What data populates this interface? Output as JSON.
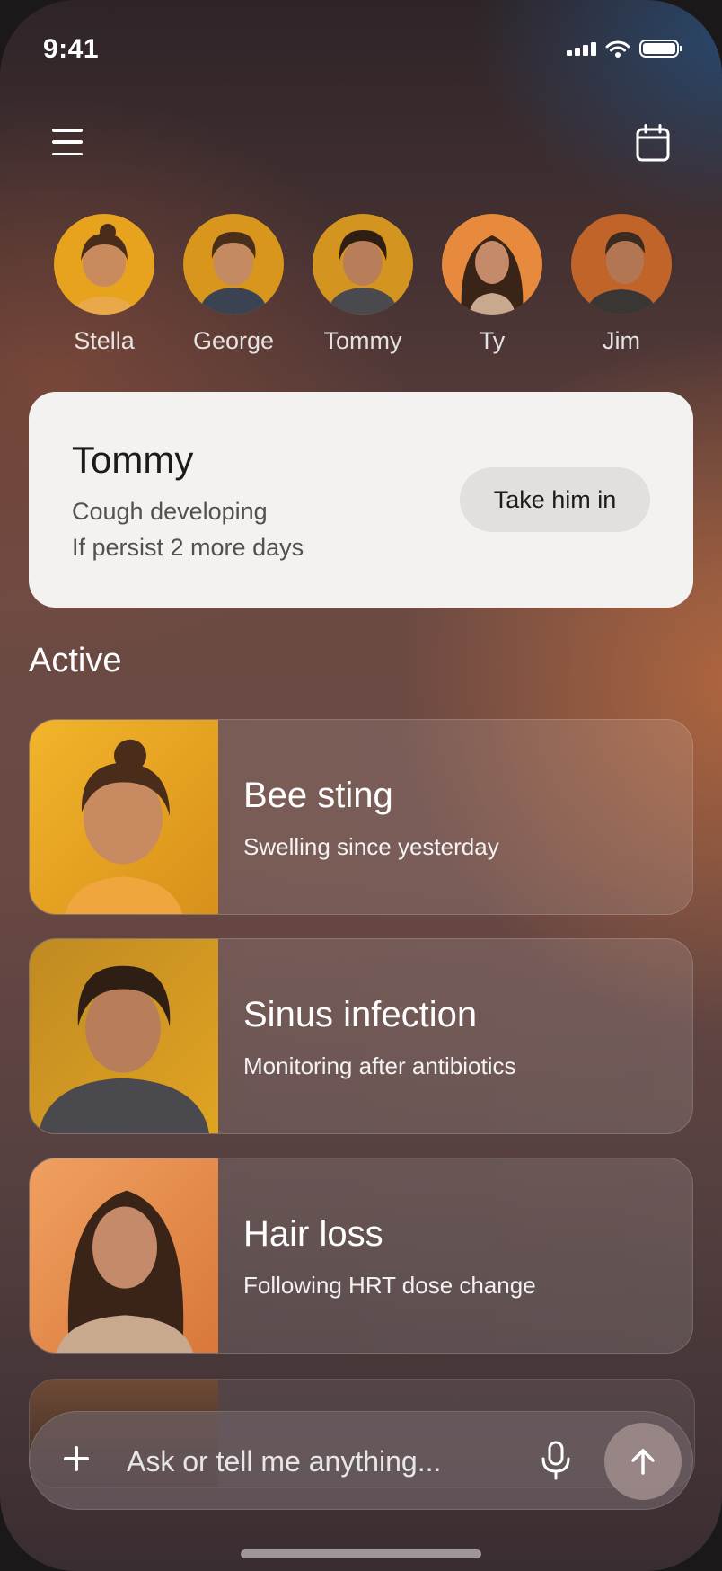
{
  "status_bar": {
    "time": "9:41"
  },
  "header": {
    "menu_icon": "hamburger-icon",
    "calendar_icon": "calendar-icon"
  },
  "people": [
    {
      "name": "Stella",
      "bg": "#e7a21e"
    },
    {
      "name": "George",
      "bg": "#d8961c"
    },
    {
      "name": "Tommy",
      "bg": "#d49420"
    },
    {
      "name": "Ty",
      "bg": "#e88a3e"
    },
    {
      "name": "Jim",
      "bg": "#c0642a"
    }
  ],
  "alert": {
    "name": "Tommy",
    "line1": "Cough developing",
    "line2": "If persist 2 more days",
    "button": "Take him in"
  },
  "section": {
    "title": "Active"
  },
  "cases": [
    {
      "title": "Bee sting",
      "subtitle": "Swelling since yesterday",
      "person": "Stella"
    },
    {
      "title": "Sinus infection",
      "subtitle": "Monitoring after antibiotics",
      "person": "Tommy"
    },
    {
      "title": "Hair loss",
      "subtitle": "Following HRT dose change",
      "person": "Ty"
    }
  ],
  "composer": {
    "placeholder": "Ask or tell me anything...",
    "mic_icon": "microphone-icon",
    "send_icon": "arrow-up-icon",
    "add_icon": "plus-icon"
  },
  "colors": {
    "card_bg": "#f4f2f1",
    "accent_orange": "#e7a21e"
  }
}
